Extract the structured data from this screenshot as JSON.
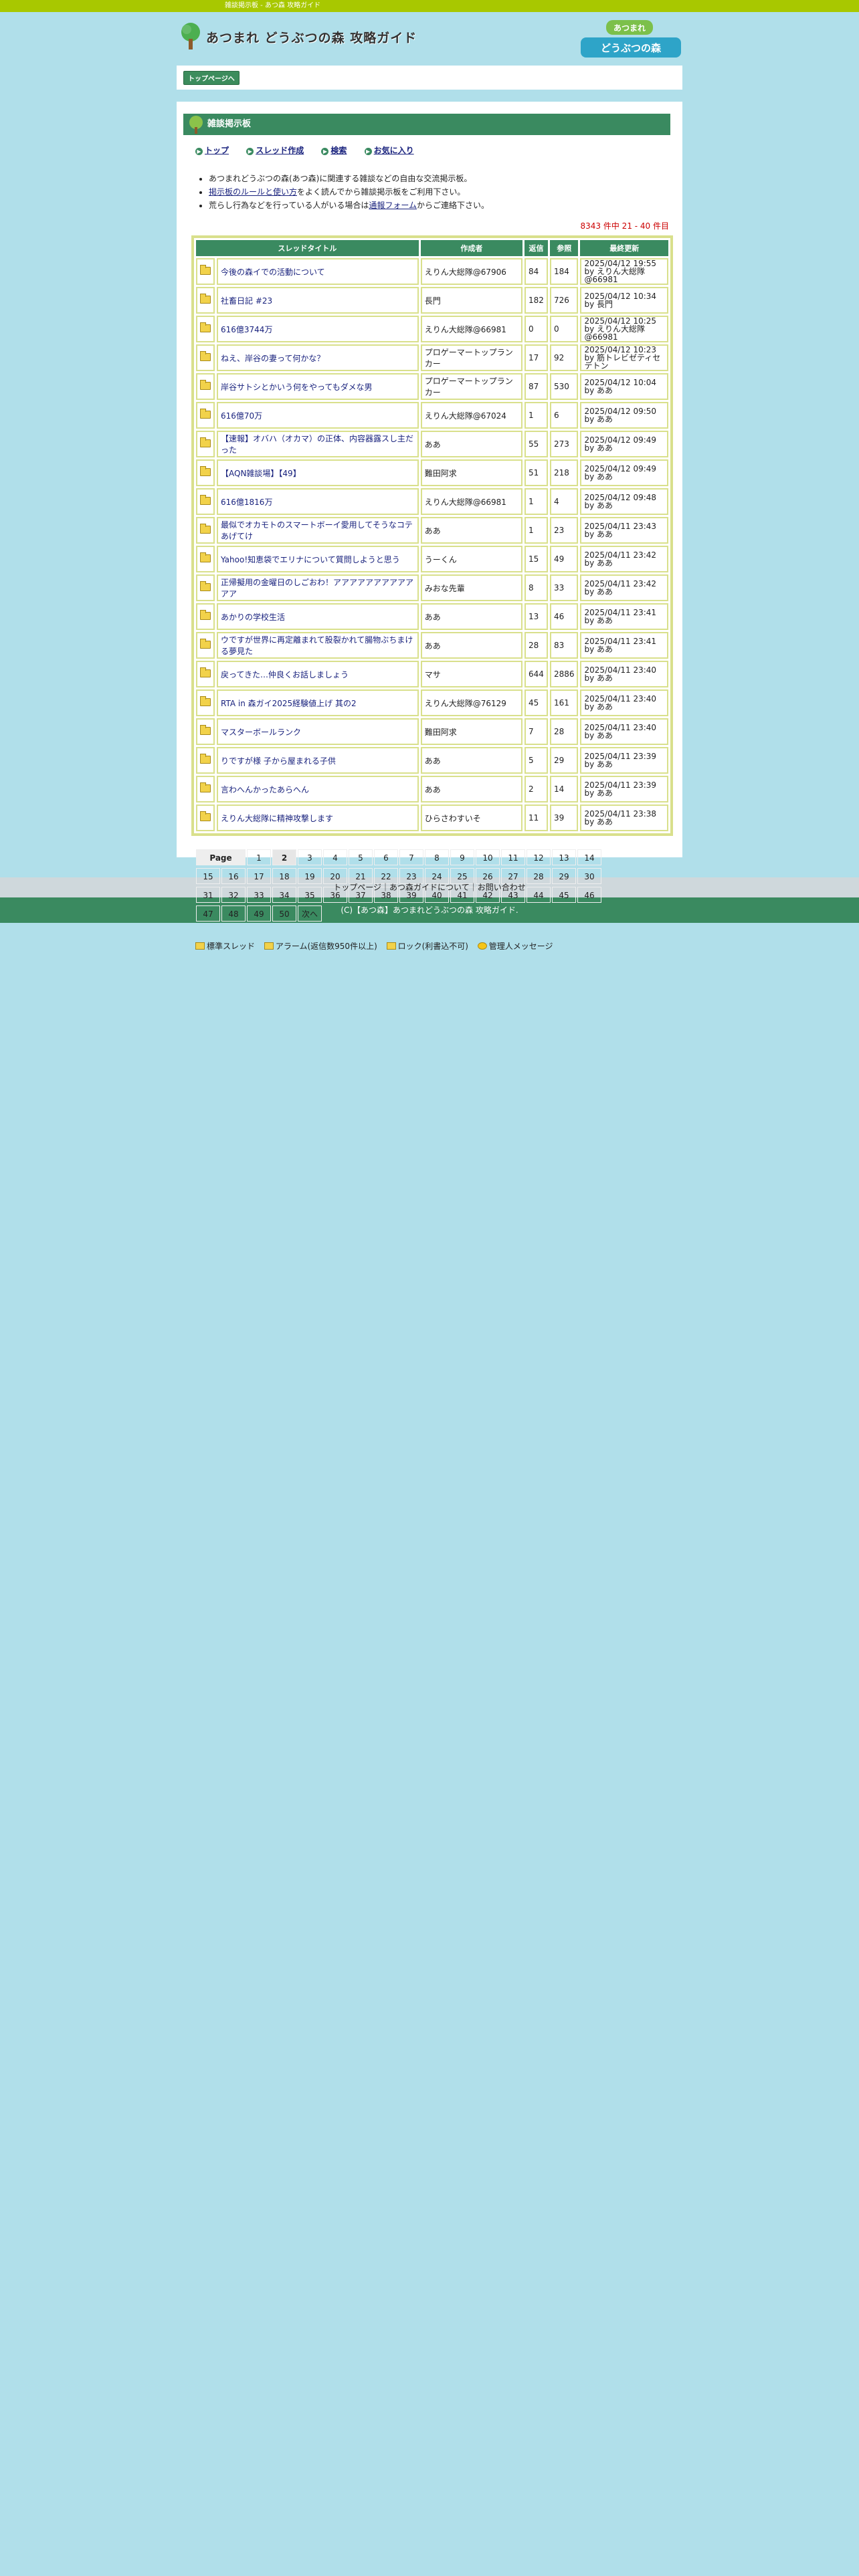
{
  "topbar": "雑談掲示板 - あつ森 攻略ガイド",
  "site_title": "あつまれ どうぶつの森 攻略ガイド",
  "game_logo": "あつまれ どうぶつの森",
  "breadcrumb": "トップページへ",
  "board": {
    "title": "雑談掲示板",
    "menu": [
      "トップ",
      "スレッド作成",
      "検索",
      "お気に入り"
    ],
    "notes": [
      {
        "before": "あつまれどうぶつの森(あつ森)に関連する雑談などの自由な交流掲示板。",
        "link": "",
        "after": ""
      },
      {
        "before": "",
        "link": "掲示板のルールと使い方",
        "after": "をよく読んでから雑談掲示板をご利用下さい。"
      },
      {
        "before": "荒らし行為などを行っている人がいる場合は",
        "link": "通報フォーム",
        "after": "からご連絡下さい。"
      }
    ],
    "count": "8343 件中 21 - 40 件目",
    "headers": [
      "スレッドタイトル",
      "作成者",
      "返信",
      "参照",
      "最終更新"
    ],
    "threads": [
      {
        "title": "今後の森イでの活動について",
        "author": "えりん大総隊@67906",
        "replies": "84",
        "views": "184",
        "date": "2025/04/12 19:55",
        "by": "by えりん大総隊@66981"
      },
      {
        "title": "社畜日記 #23",
        "author": "長門",
        "replies": "182",
        "views": "726",
        "date": "2025/04/12 10:34",
        "by": "by 長門"
      },
      {
        "title": "616億3744万",
        "author": "えりん大総隊@66981",
        "replies": "0",
        "views": "0",
        "date": "2025/04/12 10:25",
        "by": "by えりん大総隊@66981"
      },
      {
        "title": "ねえ、岸谷の妻って何かな？",
        "author": "プロゲーマートップランカー",
        "replies": "17",
        "views": "92",
        "date": "2025/04/12 10:23",
        "by": "by 筋トレビゼティセテトン"
      },
      {
        "title": "岸谷サトシとかいう何をやってもダメな男",
        "author": "プロゲーマートップランカー",
        "replies": "87",
        "views": "530",
        "date": "2025/04/12 10:04",
        "by": "by ああ"
      },
      {
        "title": "616億70万",
        "author": "えりん大総隊@67024",
        "replies": "1",
        "views": "6",
        "date": "2025/04/12 09:50",
        "by": "by ああ"
      },
      {
        "title": "【速報】オバハ（オカマ）の正体、内容器露スし主だった",
        "author": "ああ",
        "replies": "55",
        "views": "273",
        "date": "2025/04/12 09:49",
        "by": "by ああ"
      },
      {
        "title": "【AQN雑談場】【49】",
        "author": "難田阿求",
        "replies": "51",
        "views": "218",
        "date": "2025/04/12 09:49",
        "by": "by ああ"
      },
      {
        "title": "616億1816万",
        "author": "えりん大総隊@66981",
        "replies": "1",
        "views": "4",
        "date": "2025/04/12 09:48",
        "by": "by ああ"
      },
      {
        "title": "最似でオカモトのスマートボーイ愛用してそうなコテあげてけ",
        "author": "ああ",
        "replies": "1",
        "views": "23",
        "date": "2025/04/11 23:43",
        "by": "by ああ"
      },
      {
        "title": "Yahoo!知恵袋でエリナについて質問しようと思う",
        "author": "うーくん",
        "replies": "15",
        "views": "49",
        "date": "2025/04/11 23:42",
        "by": "by ああ"
      },
      {
        "title": "正帰擬用の金曜日のしごおわ！アアアアアアアアアアアア",
        "author": "みおな先輩",
        "replies": "8",
        "views": "33",
        "date": "2025/04/11 23:42",
        "by": "by ああ"
      },
      {
        "title": "あかりの学校生活",
        "author": "ああ",
        "replies": "13",
        "views": "46",
        "date": "2025/04/11 23:41",
        "by": "by ああ"
      },
      {
        "title": "ウですが世界に再定離まれて股裂かれて腸物ぶちまける夢見た",
        "author": "ああ",
        "replies": "28",
        "views": "83",
        "date": "2025/04/11 23:41",
        "by": "by ああ"
      },
      {
        "title": "戻ってきた…仲良くお話しましょう",
        "author": "マサ",
        "replies": "644",
        "views": "2886",
        "date": "2025/04/11 23:40",
        "by": "by ああ"
      },
      {
        "title": "RTA in 森ガイ2025経験値上げ 其の2",
        "author": "えりん大総隊@76129",
        "replies": "45",
        "views": "161",
        "date": "2025/04/11 23:40",
        "by": "by ああ"
      },
      {
        "title": "マスターボールランク",
        "author": "難田阿求",
        "replies": "7",
        "views": "28",
        "date": "2025/04/11 23:40",
        "by": "by ああ"
      },
      {
        "title": "りですが様 子から屋まれる子供",
        "author": "ああ",
        "replies": "5",
        "views": "29",
        "date": "2025/04/11 23:39",
        "by": "by ああ"
      },
      {
        "title": "言わへんかったあらへん",
        "author": "ああ",
        "replies": "2",
        "views": "14",
        "date": "2025/04/11 23:39",
        "by": "by ああ"
      },
      {
        "title": "えりん大総隊に精神攻撃します",
        "author": "ひらさわすいそ",
        "replies": "11",
        "views": "39",
        "date": "2025/04/11 23:38",
        "by": "by ああ"
      }
    ],
    "pager": {
      "label": "Page",
      "current": "2",
      "pages": [
        "1",
        "2",
        "3",
        "4",
        "5",
        "6",
        "7",
        "8",
        "9",
        "10",
        "11",
        "12",
        "13",
        "14",
        "15",
        "16",
        "17",
        "18",
        "19",
        "20",
        "21",
        "22",
        "23",
        "24",
        "25",
        "26",
        "27",
        "28",
        "29",
        "30",
        "31",
        "32",
        "33",
        "34",
        "35",
        "36",
        "37",
        "38",
        "39",
        "40",
        "41",
        "42",
        "43",
        "44",
        "45",
        "46",
        "47",
        "48",
        "49",
        "50"
      ],
      "next": "次へ"
    },
    "legend": [
      "標準スレッド",
      "アラーム(返信数950件以上)",
      "ロック(利書込不可)",
      "管理人メッセージ"
    ]
  },
  "footer": {
    "links": "トップページ｜あつ森ガイドについて｜お問い合わせ",
    "copyright": "(C)【あつ森】あつまれどうぶつの森 攻略ガイド."
  },
  "colors": {
    "topbar": "#a8c800",
    "green": "#3a8a60",
    "table_border": "#d9e08c",
    "bg": "#b0dfea"
  }
}
